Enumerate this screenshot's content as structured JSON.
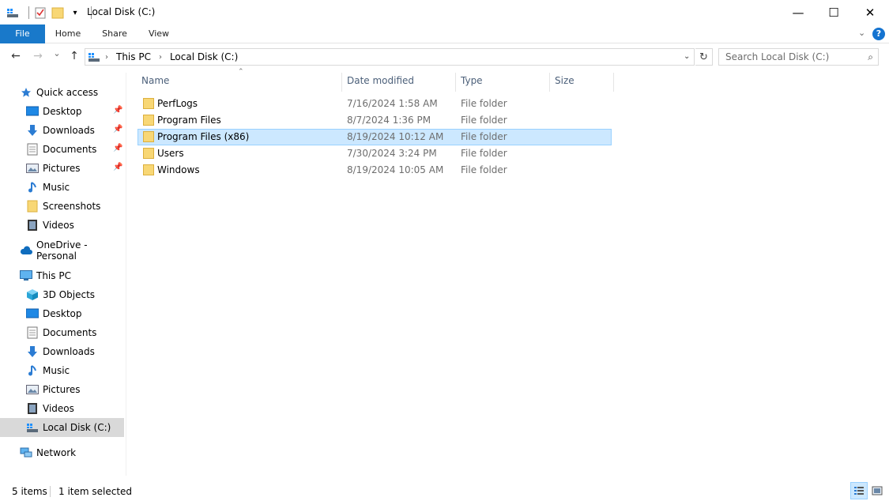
{
  "window": {
    "title": "Local Disk (C:)",
    "minimize": "—",
    "maximize": "☐",
    "close": "✕"
  },
  "ribbon": {
    "tabs": [
      "File",
      "Home",
      "Share",
      "View"
    ],
    "help": "?"
  },
  "nav": {
    "back": "←",
    "forward": "→",
    "recent": "⌄",
    "up": "↑",
    "breadcrumbs": [
      "This PC",
      "Local Disk (C:)"
    ],
    "breadcrumb_sep": "›",
    "address_dropdown": "⌄",
    "refresh": "↻",
    "search_placeholder": "Search Local Disk (C:)",
    "search_icon": "⌕"
  },
  "sidebar": {
    "items": [
      {
        "label": "Quick access",
        "icon": "star-icon"
      },
      {
        "label": "Desktop",
        "icon": "desktop-icon",
        "pinned": true
      },
      {
        "label": "Downloads",
        "icon": "download-icon",
        "pinned": true
      },
      {
        "label": "Documents",
        "icon": "document-icon",
        "pinned": true
      },
      {
        "label": "Pictures",
        "icon": "picture-icon",
        "pinned": true
      },
      {
        "label": "Music",
        "icon": "music-icon"
      },
      {
        "label": "Screenshots",
        "icon": "folder-icon"
      },
      {
        "label": "Videos",
        "icon": "video-icon"
      },
      {
        "label": "OneDrive - Personal",
        "icon": "cloud-icon"
      },
      {
        "label": "This PC",
        "icon": "computer-icon"
      },
      {
        "label": "3D Objects",
        "icon": "cube-icon"
      },
      {
        "label": "Desktop",
        "icon": "desktop-icon"
      },
      {
        "label": "Documents",
        "icon": "document-icon"
      },
      {
        "label": "Downloads",
        "icon": "download-icon"
      },
      {
        "label": "Music",
        "icon": "music-icon"
      },
      {
        "label": "Pictures",
        "icon": "picture-icon"
      },
      {
        "label": "Videos",
        "icon": "video-icon"
      },
      {
        "label": "Local Disk (C:)",
        "icon": "drive-icon",
        "selected": true
      },
      {
        "label": "Network",
        "icon": "network-icon"
      }
    ]
  },
  "list": {
    "columns": [
      "Name",
      "Date modified",
      "Type",
      "Size"
    ],
    "sort_indicator": "⌃",
    "rows": [
      {
        "name": "PerfLogs",
        "date": "7/16/2024 1:58 AM",
        "type": "File folder"
      },
      {
        "name": "Program Files",
        "date": "8/7/2024 1:36 PM",
        "type": "File folder"
      },
      {
        "name": "Program Files (x86)",
        "date": "8/19/2024 10:12 AM",
        "type": "File folder",
        "selected": true
      },
      {
        "name": "Users",
        "date": "7/30/2024 3:24 PM",
        "type": "File folder"
      },
      {
        "name": "Windows",
        "date": "8/19/2024 10:05 AM",
        "type": "File folder"
      }
    ]
  },
  "status": {
    "count": "5 items",
    "selection": "1 item selected"
  },
  "colors": {
    "accent": "#1979ca",
    "selection_bg": "#cce8ff",
    "selection_border": "#99d1ff",
    "folder": "#f8d775"
  }
}
